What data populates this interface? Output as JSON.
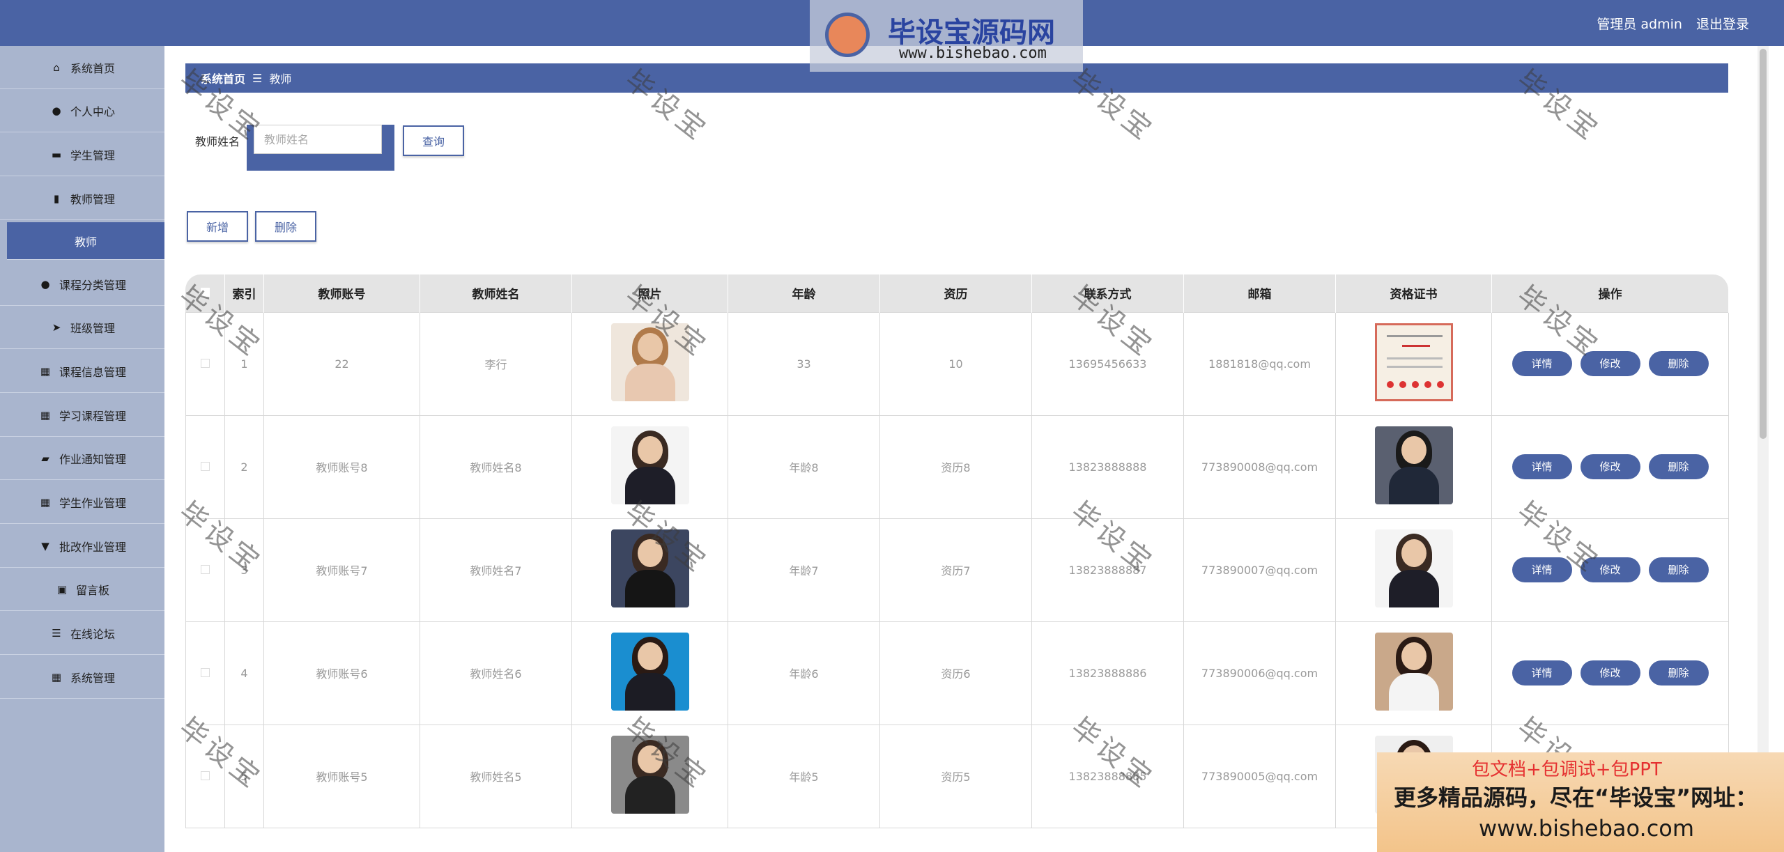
{
  "header": {
    "title": "",
    "user_role": "管理员 admin",
    "logout": "退出登录"
  },
  "watermark_logo": {
    "brand": "毕设宝源码网",
    "url": "www.bishebao.com"
  },
  "sidebar": {
    "items": [
      {
        "label": "系统首页",
        "icon": "home-icon",
        "glyph": "⌂"
      },
      {
        "label": "个人中心",
        "icon": "user-icon",
        "glyph": "●"
      },
      {
        "label": "学生管理",
        "icon": "comment-icon",
        "glyph": "▬"
      },
      {
        "label": "教师管理",
        "icon": "book-icon",
        "glyph": "▮"
      },
      {
        "label": "教师",
        "icon": "",
        "glyph": ""
      },
      {
        "label": "课程分类管理",
        "icon": "user-icon",
        "glyph": "●"
      },
      {
        "label": "班级管理",
        "icon": "paper-plane-icon",
        "glyph": "➤"
      },
      {
        "label": "课程信息管理",
        "icon": "grid-icon",
        "glyph": "▦"
      },
      {
        "label": "学习课程管理",
        "icon": "grid-icon",
        "glyph": "▦"
      },
      {
        "label": "作业通知管理",
        "icon": "ticket-icon",
        "glyph": "▰"
      },
      {
        "label": "学生作业管理",
        "icon": "grid-icon",
        "glyph": "▦"
      },
      {
        "label": "批改作业管理",
        "icon": "clipboard-icon",
        "glyph": "▼"
      },
      {
        "label": "留言板",
        "icon": "note-icon",
        "glyph": "▣"
      },
      {
        "label": "在线论坛",
        "icon": "list-icon",
        "glyph": "☰"
      },
      {
        "label": "系统管理",
        "icon": "grid-icon",
        "glyph": "▦"
      }
    ]
  },
  "breadcrumb": {
    "home": "系统首页",
    "separator": "☰",
    "current": "教师"
  },
  "search": {
    "label": "教师姓名",
    "placeholder": "教师姓名",
    "button": "查询"
  },
  "actions": {
    "add": "新增",
    "delete": "删除"
  },
  "table": {
    "columns": [
      "索引",
      "教师账号",
      "教师姓名",
      "照片",
      "年龄",
      "资历",
      "联系方式",
      "邮箱",
      "资格证书",
      "操作"
    ],
    "row_buttons": {
      "detail": "详情",
      "edit": "修改",
      "delete": "删除"
    },
    "rows": [
      {
        "index": "1",
        "account": "22",
        "name": "李行",
        "age": "33",
        "seniority": "10",
        "phone": "13695456633",
        "email": "1881818@qq.com"
      },
      {
        "index": "2",
        "account": "教师账号8",
        "name": "教师姓名8",
        "age": "年龄8",
        "seniority": "资历8",
        "phone": "13823888888",
        "email": "773890008@qq.com"
      },
      {
        "index": "3",
        "account": "教师账号7",
        "name": "教师姓名7",
        "age": "年龄7",
        "seniority": "资历7",
        "phone": "13823888887",
        "email": "773890007@qq.com"
      },
      {
        "index": "4",
        "account": "教师账号6",
        "name": "教师姓名6",
        "age": "年龄6",
        "seniority": "资历6",
        "phone": "13823888886",
        "email": "773890006@qq.com"
      },
      {
        "index": "5",
        "account": "教师账号5",
        "name": "教师姓名5",
        "age": "年龄5",
        "seniority": "资历5",
        "phone": "13823888885",
        "email": "773890005@qq.com"
      }
    ]
  },
  "watermark_text": "毕设宝",
  "ad": {
    "line1": "包文档+包调试+包PPT",
    "line2": "更多精品源码，尽在“毕设宝”网址：",
    "line3": "www.bishebao.com"
  },
  "colors": {
    "primary": "#4a63a4",
    "sidebar_bg": "#a9b5ce",
    "table_head": "#e4e4e4"
  }
}
